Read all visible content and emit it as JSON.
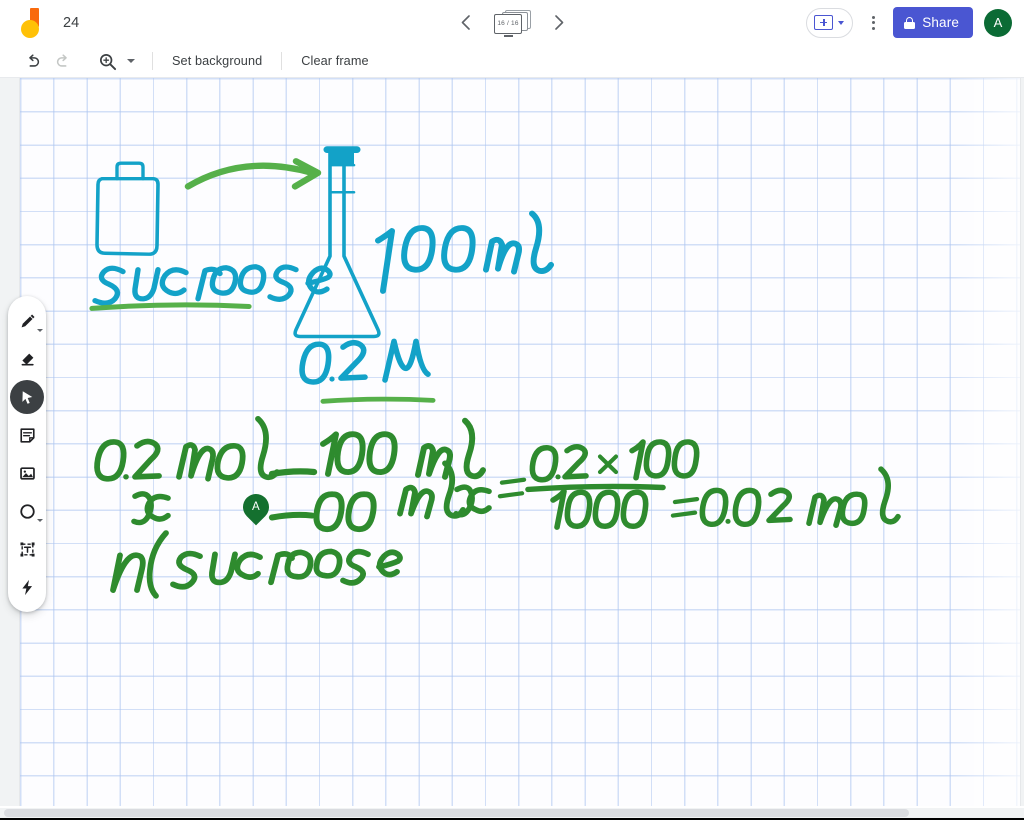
{
  "app": {
    "name": "Jamboard",
    "logo_colors": {
      "bar": "#F96A0D",
      "dot": "#FFC107"
    }
  },
  "topbar": {
    "document_title": "24",
    "prev_frame_label": "Previous frame",
    "next_frame_label": "Next frame",
    "frame_counter": "16 / 16",
    "present_label": "Present",
    "present_caret_label": "Present options",
    "more_label": "More actions",
    "share_label": "Share",
    "share_color": "#4A56D2",
    "avatar_initial": "A",
    "avatar_color": "#0B6B35"
  },
  "subtoolbar": {
    "undo_label": "Undo",
    "redo_label": "Redo",
    "zoom_label": "Zoom",
    "zoom_caret_label": "Zoom options",
    "set_background_label": "Set background",
    "clear_frame_label": "Clear frame"
  },
  "toolrail": {
    "items": [
      {
        "name": "pen-tool",
        "label": "Pen",
        "active": false,
        "has_submenu": true
      },
      {
        "name": "eraser-tool",
        "label": "Eraser",
        "active": false,
        "has_submenu": false
      },
      {
        "name": "select-tool",
        "label": "Select",
        "active": true,
        "has_submenu": false
      },
      {
        "name": "sticky-note-tool",
        "label": "Sticky note",
        "active": false,
        "has_submenu": false
      },
      {
        "name": "image-tool",
        "label": "Add image",
        "active": false,
        "has_submenu": false
      },
      {
        "name": "shape-tool",
        "label": "Shape",
        "active": false,
        "has_submenu": true
      },
      {
        "name": "text-box-tool",
        "label": "Text box",
        "active": false,
        "has_submenu": false
      },
      {
        "name": "laser-tool",
        "label": "Laser pointer",
        "active": false,
        "has_submenu": false
      }
    ]
  },
  "canvas": {
    "background": "grid-paper",
    "grid_color": "#AEC6F0",
    "ink_colors": {
      "cyan": "#13A2C8",
      "green": "#56B04A",
      "dark_green": "#2E8B2E"
    },
    "annotations": [
      {
        "name": "sucrose-bottle-drawing",
        "text": "",
        "color": "#13A2C8"
      },
      {
        "name": "transfer-arrow",
        "text": "",
        "color": "#56B04A"
      },
      {
        "name": "volumetric-flask-drawing",
        "text": "",
        "color": "#13A2C8"
      },
      {
        "name": "sucrose-label",
        "text": "sucrose",
        "color": "#13A2C8"
      },
      {
        "name": "volume-label",
        "text": "100 mL",
        "color": "#13A2C8"
      },
      {
        "name": "concentration-label",
        "text": "0.2 M",
        "color": "#13A2C8"
      },
      {
        "name": "proportion-numerator-left",
        "text": "0.2 mol",
        "color": "#2E8B2E"
      },
      {
        "name": "proportion-denominator-left",
        "text": "x",
        "color": "#2E8B2E"
      },
      {
        "name": "proportion-numerator-right",
        "text": "1000 mL",
        "color": "#2E8B2E"
      },
      {
        "name": "proportion-denominator-right",
        "text": "100 mL",
        "color": "#2E8B2E"
      },
      {
        "name": "moles-sucrose-label",
        "text": "n( sucrose",
        "color": "#2E8B2E"
      },
      {
        "name": "solution-equation",
        "text": "x = 0.2 x 100 / 1000 = 0.02 mol",
        "color": "#2E8B2E"
      },
      {
        "name": "solution-numerator",
        "text": "0.2 x 100",
        "color": "#2E8B2E"
      },
      {
        "name": "solution-denominator",
        "text": "1000",
        "color": "#2E8B2E"
      },
      {
        "name": "solution-result",
        "text": "= 0.02 mol",
        "color": "#2E8B2E"
      }
    ]
  },
  "collaborator_cursor": {
    "initial": "A",
    "color": "#14702F"
  },
  "scrollbar": {
    "orientation": "horizontal"
  }
}
